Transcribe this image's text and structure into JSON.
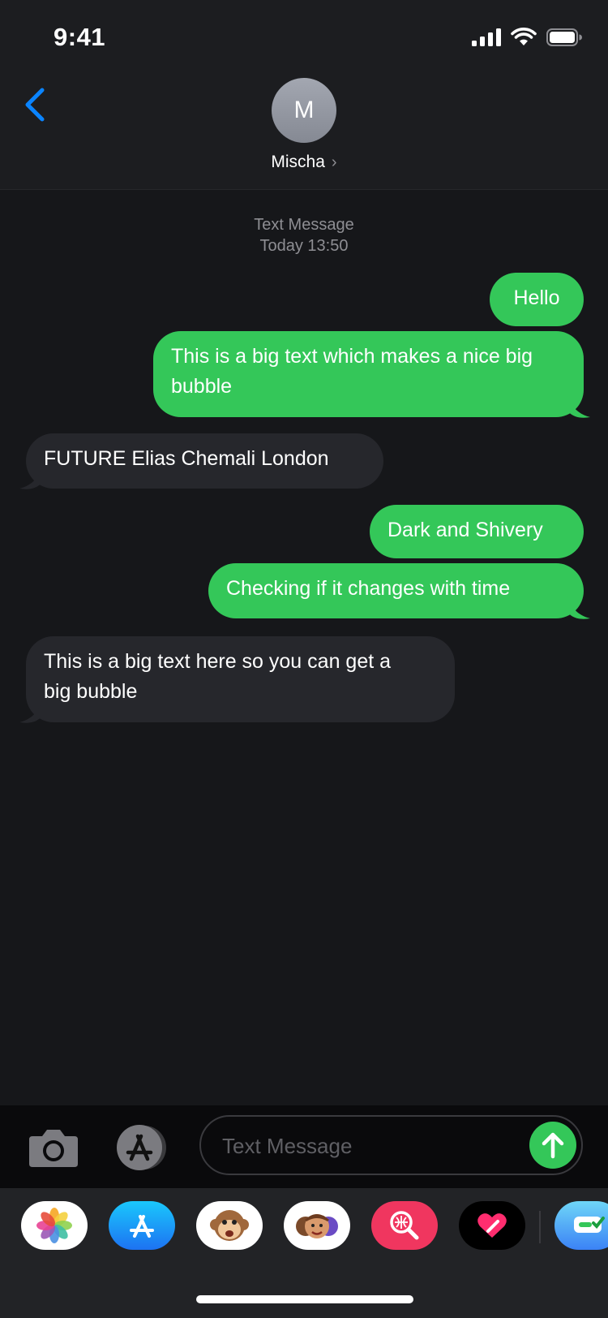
{
  "status_bar": {
    "time": "9:41"
  },
  "header": {
    "avatar_initial": "M",
    "contact_name": "Mischa",
    "chevron": "›"
  },
  "thread": {
    "service_label": "Text Message",
    "timestamp": "Today  13:50"
  },
  "messages": [
    {
      "direction": "outgoing",
      "text": "Hello"
    },
    {
      "direction": "outgoing",
      "text": "This is a big text which makes a nice big bubble"
    },
    {
      "direction": "incoming",
      "text": "FUTURE Elias Chemali London"
    },
    {
      "direction": "outgoing",
      "text": "Dark and Shivery"
    },
    {
      "direction": "outgoing",
      "text": "Checking if it changes with time"
    },
    {
      "direction": "incoming",
      "text": "This is a big text here so you can get a big bubble"
    }
  ],
  "composer": {
    "placeholder": "Text Message"
  },
  "app_drawer": {
    "items": [
      "photos-icon",
      "app-store-icon",
      "monkey-animoji-icon",
      "memoji-stickers-icon",
      "web-search-icon",
      "digital-touch-icon",
      "messages-app-icon"
    ]
  },
  "colors": {
    "background": "#16171a",
    "outgoing_bubble": "#34c759",
    "incoming_bubble": "#26272c",
    "accent_blue": "#0a84ff"
  }
}
